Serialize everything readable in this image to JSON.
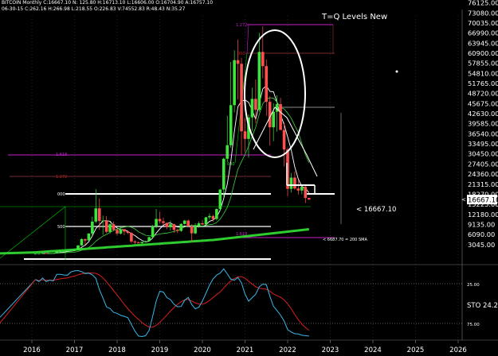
{
  "header": {
    "line1": "BITCOIN Monthly  C:16667.10   N:    125.80  H:16713.10  L:16606.00  O:16704.90  A:16757.10",
    "line2": "06-30-15  C:262.16  H:266.98  L:218.55  O:226.83  V:74552.83  R:48.43  N:35.27"
  },
  "chart_data": {
    "type": "candlestick",
    "title": "T=Q Levels New",
    "years": [
      "2016",
      "2017",
      "2018",
      "2019",
      "2020",
      "2021",
      "2022",
      "2023",
      "2024",
      "2025",
      "2026"
    ],
    "price_axis_labels": [
      3045,
      6090,
      9135,
      12180,
      15225,
      18270,
      21315,
      24360,
      27405,
      30450,
      33495,
      36540,
      39585,
      42630,
      45675,
      48720,
      51765,
      54810,
      57855,
      60900,
      63945,
      66990,
      70035,
      73080,
      76125
    ],
    "last_price": "16667.10",
    "last_price_callout": "< 16667.10",
    "sma_label": "< 6687.70 = 200 SMA",
    "fib_labels": [
      "1.272",
      "000",
      "1.618",
      "1.272",
      "000",
      "500",
      "1.618",
      "000"
    ],
    "sto_label": "STO",
    "sto_value": "24.2",
    "sto_levels": [
      "25.00",
      "75.00"
    ],
    "candles": [
      [
        230,
        270,
        210,
        260
      ],
      [
        260,
        300,
        250,
        280
      ],
      [
        280,
        440,
        270,
        430
      ],
      [
        430,
        460,
        360,
        380
      ],
      [
        380,
        430,
        370,
        420
      ],
      [
        420,
        460,
        400,
        440
      ],
      [
        440,
        1000,
        430,
        970
      ],
      [
        970,
        1150,
        750,
        1000
      ],
      [
        1000,
        1080,
        900,
        1050
      ],
      [
        1050,
        1250,
        1000,
        1200
      ],
      [
        1200,
        1250,
        1100,
        1230
      ],
      [
        1230,
        1480,
        1180,
        1400
      ],
      [
        1400,
        2900,
        1300,
        2800
      ],
      [
        2800,
        5000,
        2700,
        4700
      ],
      [
        4700,
        4900,
        3000,
        4300
      ],
      [
        4300,
        6500,
        4100,
        6400
      ],
      [
        6400,
        11500,
        5500,
        10000
      ],
      [
        10000,
        19800,
        9500,
        14000
      ],
      [
        14000,
        17000,
        7500,
        10200
      ],
      [
        10200,
        11800,
        6000,
        10300
      ],
      [
        10300,
        11700,
        6500,
        6900
      ],
      [
        6900,
        9900,
        6400,
        9200
      ],
      [
        9200,
        10000,
        7300,
        7500
      ],
      [
        7500,
        7800,
        5800,
        6400
      ],
      [
        6400,
        8500,
        6100,
        7700
      ],
      [
        7700,
        7800,
        5900,
        7000
      ],
      [
        7000,
        7400,
        6200,
        6600
      ],
      [
        6600,
        6900,
        3500,
        4000
      ],
      [
        4000,
        4400,
        3200,
        3700
      ],
      [
        3700,
        4000,
        3400,
        3450
      ],
      [
        3450,
        3900,
        3350,
        3850
      ],
      [
        3850,
        4200,
        3700,
        4100
      ],
      [
        4100,
        5500,
        4000,
        5300
      ],
      [
        5300,
        9000,
        5100,
        8600
      ],
      [
        8600,
        13800,
        8000,
        10800
      ],
      [
        10800,
        13000,
        9400,
        10100
      ],
      [
        10100,
        11200,
        9000,
        9600
      ],
      [
        9600,
        9700,
        7700,
        8300
      ],
      [
        8300,
        10300,
        7300,
        9200
      ],
      [
        9200,
        9400,
        6600,
        7500
      ],
      [
        7500,
        7900,
        6500,
        7200
      ],
      [
        7200,
        9500,
        6900,
        9300
      ],
      [
        9300,
        10500,
        9100,
        10300
      ],
      [
        10300,
        10600,
        8500,
        8600
      ],
      [
        8600,
        9200,
        3800,
        6450
      ],
      [
        6450,
        9500,
        6150,
        8650
      ],
      [
        8650,
        10000,
        8100,
        9500
      ],
      [
        9500,
        10400,
        8900,
        9150
      ],
      [
        9150,
        11400,
        9000,
        11300
      ],
      [
        11300,
        12500,
        10600,
        11700
      ],
      [
        11700,
        12100,
        9900,
        10800
      ],
      [
        10800,
        14000,
        10400,
        13800
      ],
      [
        13800,
        19900,
        13200,
        19700
      ],
      [
        19700,
        29300,
        17500,
        29000
      ],
      [
        29000,
        42000,
        28000,
        33100
      ],
      [
        33100,
        58300,
        32300,
        45200
      ],
      [
        45200,
        61800,
        43000,
        58800
      ],
      [
        58800,
        65000,
        46900,
        57700
      ],
      [
        57700,
        59500,
        30000,
        37300
      ],
      [
        37300,
        41300,
        31000,
        35000
      ],
      [
        35000,
        42400,
        29300,
        41500
      ],
      [
        41500,
        50500,
        37400,
        47100
      ],
      [
        47100,
        53000,
        39700,
        43800
      ],
      [
        43800,
        67000,
        43300,
        61300
      ],
      [
        61300,
        69000,
        53300,
        57000
      ],
      [
        57000,
        59000,
        42000,
        46200
      ],
      [
        46200,
        47900,
        33000,
        38500
      ],
      [
        38500,
        45800,
        34300,
        43200
      ],
      [
        43200,
        48200,
        37200,
        45500
      ],
      [
        45500,
        47400,
        37700,
        37700
      ],
      [
        37700,
        40000,
        26700,
        31800
      ],
      [
        31800,
        32400,
        17600,
        19900
      ],
      [
        19900,
        24700,
        18800,
        23300
      ],
      [
        23300,
        25200,
        19600,
        20000
      ],
      [
        20000,
        22700,
        18200,
        19400
      ],
      [
        19400,
        20500,
        18200,
        20500
      ],
      [
        20500,
        21000,
        15600,
        17150
      ],
      [
        17150,
        17200,
        16600,
        16667
      ]
    ]
  }
}
